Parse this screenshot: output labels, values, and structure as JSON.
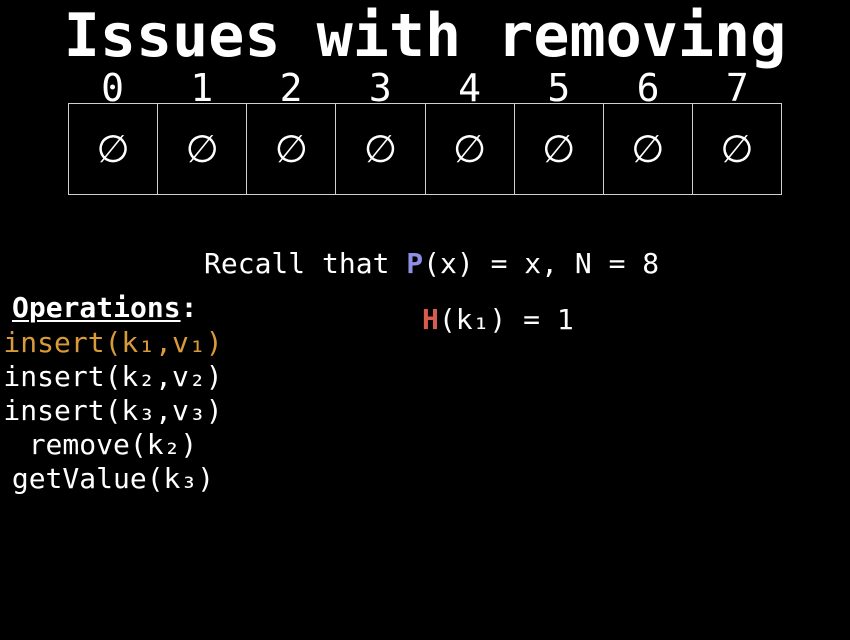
{
  "title": "Issues with removing",
  "array": {
    "indices": [
      "0",
      "1",
      "2",
      "3",
      "4",
      "5",
      "6",
      "7"
    ],
    "cells": [
      "∅",
      "∅",
      "∅",
      "∅",
      "∅",
      "∅",
      "∅",
      "∅"
    ]
  },
  "recall": {
    "prefix": "Recall that ",
    "fn": "P",
    "rest": "(x) = x, N = 8"
  },
  "hash": {
    "fn": "H",
    "rest": "(k₁) = 1"
  },
  "operations": {
    "heading": "Operations",
    "colon": ":",
    "items": [
      "insert(k₁,v₁)",
      "insert(k₂,v₂)",
      "insert(k₃,v₃)",
      "remove(k₂)",
      "getValue(k₃)"
    ]
  },
  "colors": {
    "background": "#000000",
    "text": "#ffffff",
    "p_function": "#8f8fe6",
    "h_function": "#d65c4f",
    "active_operation": "#d99a3a"
  }
}
